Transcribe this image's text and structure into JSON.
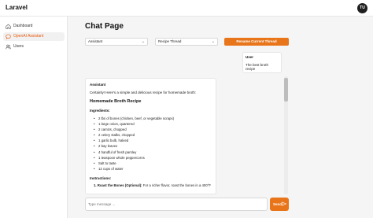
{
  "app": {
    "brand": "Laravel",
    "avatar_initials": "TU"
  },
  "sidebar": {
    "items": [
      {
        "label": "Dashboard",
        "icon": "home-icon",
        "active": false
      },
      {
        "label": "OpenAI Assistant",
        "icon": "chat-bubble-icon",
        "active": true
      },
      {
        "label": "Users",
        "icon": "users-icon",
        "active": false
      }
    ]
  },
  "page": {
    "title": "Chat Page"
  },
  "toolbar": {
    "assistant_select": "Assistant",
    "thread_select": "Recipe Thread",
    "rename_label": "Rename Current Thread"
  },
  "user_message": {
    "role": "User",
    "text": "The best broth recipe"
  },
  "assistant_message": {
    "role": "Assistant",
    "intro": "Certainly! Here's a simple and delicious recipe for homemade broth:",
    "recipe_title": "Homemade Broth Recipe",
    "ingredients_heading": "Ingredients:",
    "ingredients": [
      "2 lbs of bones (chicken, beef, or vegetable scraps)",
      "1 large onion, quartered",
      "2 carrots, chopped",
      "2 celery stalks, chopped",
      "1 garlic bulb, halved",
      "2 bay leaves",
      "4 handful of fresh parsley",
      "1 teaspoon whole peppercorns",
      "Salt to taste",
      "12 cups of water"
    ],
    "instructions_heading": "Instructions:",
    "step1_title": "1. Roast the Bones (Optional):",
    "step1_text": " For a richer flavor, roast the bones in a 400°F"
  },
  "composer": {
    "placeholder": "Type message ...",
    "send_label": "Send"
  },
  "colors": {
    "accent": "#e8751a",
    "active_nav": "#ea580c"
  }
}
